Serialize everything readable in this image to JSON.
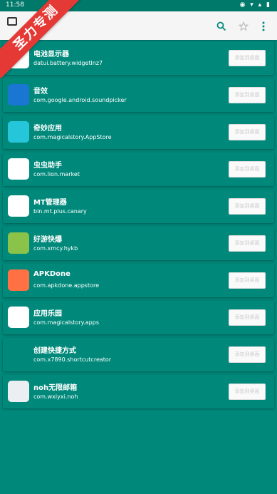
{
  "status": {
    "time": "11:58",
    "icons": "◉ ▾ ▴ ▮"
  },
  "watermark": "圣力专测",
  "toolbar": {
    "left_icon": "window-icon",
    "search": "search-icon",
    "star": "star-icon",
    "more": "more-vert-icon"
  },
  "action_label": "添加到桌面",
  "apps": [
    {
      "name": "电池显示器",
      "package": "datui.battery.widgetlnz7",
      "icon": "battery-icon",
      "icon_color": "#ffffff"
    },
    {
      "name": "音效",
      "package": "com.google.android.soundpicker",
      "icon": "soundpicker-icon",
      "icon_color": "#1976d2"
    },
    {
      "name": "奇妙应用",
      "package": "com.magicalstory.AppStore",
      "icon": "magic-icon",
      "icon_color": "#26c6da"
    },
    {
      "name": "虫虫助手",
      "package": "com.lion.market",
      "icon": "chong-icon",
      "icon_color": "#ffffff"
    },
    {
      "name": "MT管理器",
      "package": "bin.mt.plus.canary",
      "icon": "mt-icon",
      "icon_color": "#ffffff"
    },
    {
      "name": "好游快爆",
      "package": "com.xmcy.hykb",
      "icon": "hykb-icon",
      "icon_color": "#8bc34a"
    },
    {
      "name": "APKDone",
      "package": "com.apkdone.appstore",
      "icon": "apkdone-icon",
      "icon_color": "#ff7043"
    },
    {
      "name": "应用乐园",
      "package": "com.magicalstory.apps",
      "icon": "android-icon",
      "icon_color": "#ffffff"
    },
    {
      "name": "创建快捷方式",
      "package": "com.x7890.shortcutcreator",
      "icon": "shortcut-icon",
      "icon_color": "#00897b"
    },
    {
      "name": "noh无限邮箱",
      "package": "com.wxiyxi.noh",
      "icon": "mail-icon",
      "icon_color": "#eceff1"
    }
  ]
}
